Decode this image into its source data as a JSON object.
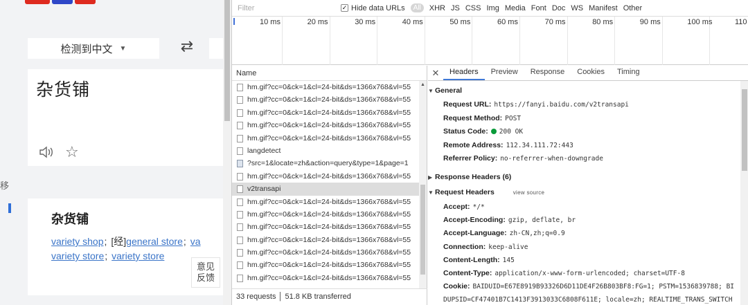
{
  "translate": {
    "lang_detect": "检测到中文",
    "source_text": "杂货铺",
    "side_char": "移",
    "result_title": "杂货铺",
    "result_line1": [
      {
        "text": "variety shop",
        "link": true,
        "sep": ";"
      },
      {
        "text": "[经]",
        "link": false,
        "sep": ""
      },
      {
        "text": "general store",
        "link": true,
        "sep": ";"
      },
      {
        "text": "va",
        "link": true,
        "sep": ""
      }
    ],
    "result_line2": [
      {
        "text": "variety store",
        "link": true,
        "sep": ";"
      },
      {
        "text": "variety store",
        "link": true,
        "sep": ""
      }
    ],
    "feedback_1": "意见",
    "feedback_2": "反馈"
  },
  "devtools": {
    "filter_placeholder": "Filter",
    "hide_data_urls": "Hide data URLs",
    "all_label": "All",
    "types": [
      "XHR",
      "JS",
      "CSS",
      "Img",
      "Media",
      "Font",
      "Doc",
      "WS",
      "Manifest",
      "Other"
    ],
    "timeline_ticks": [
      "10 ms",
      "20 ms",
      "30 ms",
      "40 ms",
      "50 ms",
      "60 ms",
      "70 ms",
      "80 ms",
      "90 ms",
      "100 ms",
      "110"
    ],
    "list_header": "Name",
    "requests": [
      {
        "name": "hm.gif?cc=0&ck=1&cl=24-bit&ds=1366x768&vl=55",
        "type": "doc",
        "selected": false
      },
      {
        "name": "hm.gif?cc=0&ck=1&cl=24-bit&ds=1366x768&vl=55",
        "type": "doc",
        "selected": false
      },
      {
        "name": "hm.gif?cc=0&ck=1&cl=24-bit&ds=1366x768&vl=55",
        "type": "doc",
        "selected": false
      },
      {
        "name": "hm.gif?cc=0&ck=1&cl=24-bit&ds=1366x768&vl=55",
        "type": "doc",
        "selected": false
      },
      {
        "name": "hm.gif?cc=0&ck=1&cl=24-bit&ds=1366x768&vl=55",
        "type": "doc",
        "selected": false
      },
      {
        "name": "langdetect",
        "type": "doc",
        "selected": false
      },
      {
        "name": "?src=1&locate=zh&action=query&type=1&page=1",
        "type": "img",
        "selected": false
      },
      {
        "name": "hm.gif?cc=0&ck=1&cl=24-bit&ds=1366x768&vl=55",
        "type": "doc",
        "selected": false
      },
      {
        "name": "v2transapi",
        "type": "doc",
        "selected": true
      },
      {
        "name": "hm.gif?cc=0&ck=1&cl=24-bit&ds=1366x768&vl=55",
        "type": "doc",
        "selected": false
      },
      {
        "name": "hm.gif?cc=0&ck=1&cl=24-bit&ds=1366x768&vl=55",
        "type": "doc",
        "selected": false
      },
      {
        "name": "hm.gif?cc=0&ck=1&cl=24-bit&ds=1366x768&vl=55",
        "type": "doc",
        "selected": false
      },
      {
        "name": "hm.gif?cc=0&ck=1&cl=24-bit&ds=1366x768&vl=55",
        "type": "doc",
        "selected": false
      },
      {
        "name": "hm.gif?cc=0&ck=1&cl=24-bit&ds=1366x768&vl=55",
        "type": "doc",
        "selected": false
      },
      {
        "name": "hm.gif?cc=0&ck=1&cl=24-bit&ds=1366x768&vl=55",
        "type": "doc",
        "selected": false
      },
      {
        "name": "hm.gif?cc=0&ck=1&cl=24-bit&ds=1366x768&vl=55",
        "type": "doc",
        "selected": false
      }
    ],
    "status_bar": "33 requests │ 51.8 KB transferred",
    "tabs": [
      "Headers",
      "Preview",
      "Response",
      "Cookies",
      "Timing"
    ],
    "active_tab": "Headers",
    "general_label": "General",
    "general": [
      {
        "k": "Request URL:",
        "v": "https://fanyi.baidu.com/v2transapi"
      },
      {
        "k": "Request Method:",
        "v": "POST"
      },
      {
        "k": "Status Code:",
        "v": "200 OK",
        "status": true
      },
      {
        "k": "Remote Address:",
        "v": "112.34.111.72:443"
      },
      {
        "k": "Referrer Policy:",
        "v": "no-referrer-when-downgrade"
      }
    ],
    "response_headers_label": "Response Headers (6)",
    "request_headers_label": "Request Headers",
    "view_source": "view source",
    "request_headers": [
      {
        "k": "Accept:",
        "v": "*/*"
      },
      {
        "k": "Accept-Encoding:",
        "v": "gzip, deflate, br"
      },
      {
        "k": "Accept-Language:",
        "v": "zh-CN,zh;q=0.9"
      },
      {
        "k": "Connection:",
        "v": "keep-alive"
      },
      {
        "k": "Content-Length:",
        "v": "145"
      },
      {
        "k": "Content-Type:",
        "v": "application/x-www-form-urlencoded; charset=UTF-8"
      },
      {
        "k": "Cookie:",
        "v": "BAIDUID=E67E8919B93326D6D11DE4F26B803BF8:FG=1; PSTM=1536839788; BI"
      },
      {
        "k": "",
        "v": "DUPSID=CF47401B7C1413F3913033C6808F611E; locale=zh; REALTIME_TRANS_SWITCH"
      }
    ]
  },
  "colors": {
    "accent": "#3f79d6",
    "link": "#3a74c8",
    "status_ok": "#0a9b3a"
  }
}
